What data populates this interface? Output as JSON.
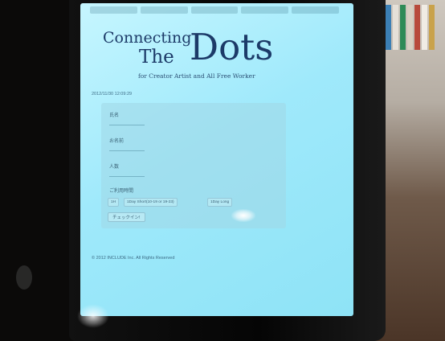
{
  "logo": {
    "connecting": "Connecting",
    "the": "The",
    "dots": "Dots",
    "tagline": "for Creator Artist and All Free Worker"
  },
  "datetime": "2012/11/30 12:09:29",
  "form": {
    "name_label": "氏名",
    "affiliation_label": "お名前",
    "people_label": "人数",
    "plan_label": "ご利用時間",
    "plan_options": [
      "1H",
      "1Day Short(10-19 or 19-23)",
      "1Day Long"
    ],
    "checkin_button": "チェックイン!"
  },
  "copyright": "© 2012 INCLUDE Inc. All Rights Reserved",
  "colors": {
    "screen_bg": "#9fe9fb",
    "logo_text": "#1c3a68",
    "frame": "#0b0a09"
  }
}
